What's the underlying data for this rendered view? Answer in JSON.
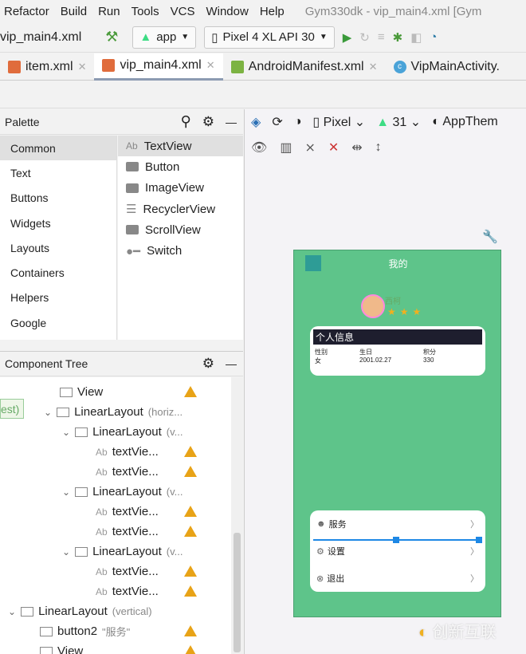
{
  "menu": [
    "Refactor",
    "Build",
    "Run",
    "Tools",
    "VCS",
    "Window",
    "Help"
  ],
  "window_title": "Gym330dk - vip_main4.xml [Gym",
  "toolbar": {
    "file": "vip_main4.xml",
    "module": "app",
    "device": "Pixel 4 XL API 30"
  },
  "tabs": [
    {
      "label": "item.xml"
    },
    {
      "label": "vip_main4.xml"
    },
    {
      "label": "AndroidManifest.xml"
    },
    {
      "label": "VipMainActivity."
    }
  ],
  "palette": {
    "title": "Palette",
    "categories": [
      "Common",
      "Text",
      "Buttons",
      "Widgets",
      "Layouts",
      "Containers",
      "Helpers",
      "Google"
    ],
    "items": [
      "TextView",
      "Button",
      "ImageView",
      "RecyclerView",
      "ScrollView",
      "Switch"
    ]
  },
  "design_toolbar": {
    "device": "Pixel",
    "api": "31",
    "theme": "AppThem"
  },
  "tree": {
    "title": "Component Tree",
    "side_label": "est)",
    "rows": [
      {
        "label": "View",
        "hint": "",
        "indent": 75,
        "warn": true
      },
      {
        "label": "LinearLayout",
        "hint": "(horiz...",
        "indent": 75,
        "warn": false,
        "expand": true
      },
      {
        "label": "LinearLayout",
        "hint": "(v...",
        "indent": 98,
        "warn": false,
        "expand": true
      },
      {
        "label": "textVie...",
        "hint": "",
        "indent": 120,
        "warn": true
      },
      {
        "label": "textVie...",
        "hint": "",
        "indent": 120,
        "warn": true
      },
      {
        "label": "LinearLayout",
        "hint": "(v...",
        "indent": 98,
        "warn": false,
        "expand": true
      },
      {
        "label": "textVie...",
        "hint": "",
        "indent": 120,
        "warn": true
      },
      {
        "label": "textVie...",
        "hint": "",
        "indent": 120,
        "warn": true
      },
      {
        "label": "LinearLayout",
        "hint": "(v...",
        "indent": 98,
        "warn": false,
        "expand": true
      },
      {
        "label": "textVie...",
        "hint": "",
        "indent": 120,
        "warn": true
      },
      {
        "label": "textVie...",
        "hint": "",
        "indent": 120,
        "warn": true
      },
      {
        "label": "LinearLayout",
        "hint": "(vertical)",
        "indent": 30,
        "warn": false,
        "expand": true
      },
      {
        "label": "button2",
        "hint": "\"服务\"",
        "indent": 50,
        "warn": true
      },
      {
        "label": "View",
        "hint": "",
        "indent": 50,
        "warn": true
      }
    ]
  },
  "phone": {
    "title": "我的",
    "name": "西柯",
    "stars": 3,
    "info_title": "个人信息",
    "info": [
      {
        "label": "性别",
        "value": "女"
      },
      {
        "label": "生日",
        "value": "2001.02.27"
      },
      {
        "label": "积分",
        "value": "330"
      }
    ],
    "menu": [
      "服务",
      "设置",
      "退出"
    ]
  },
  "watermark": "创新互联"
}
